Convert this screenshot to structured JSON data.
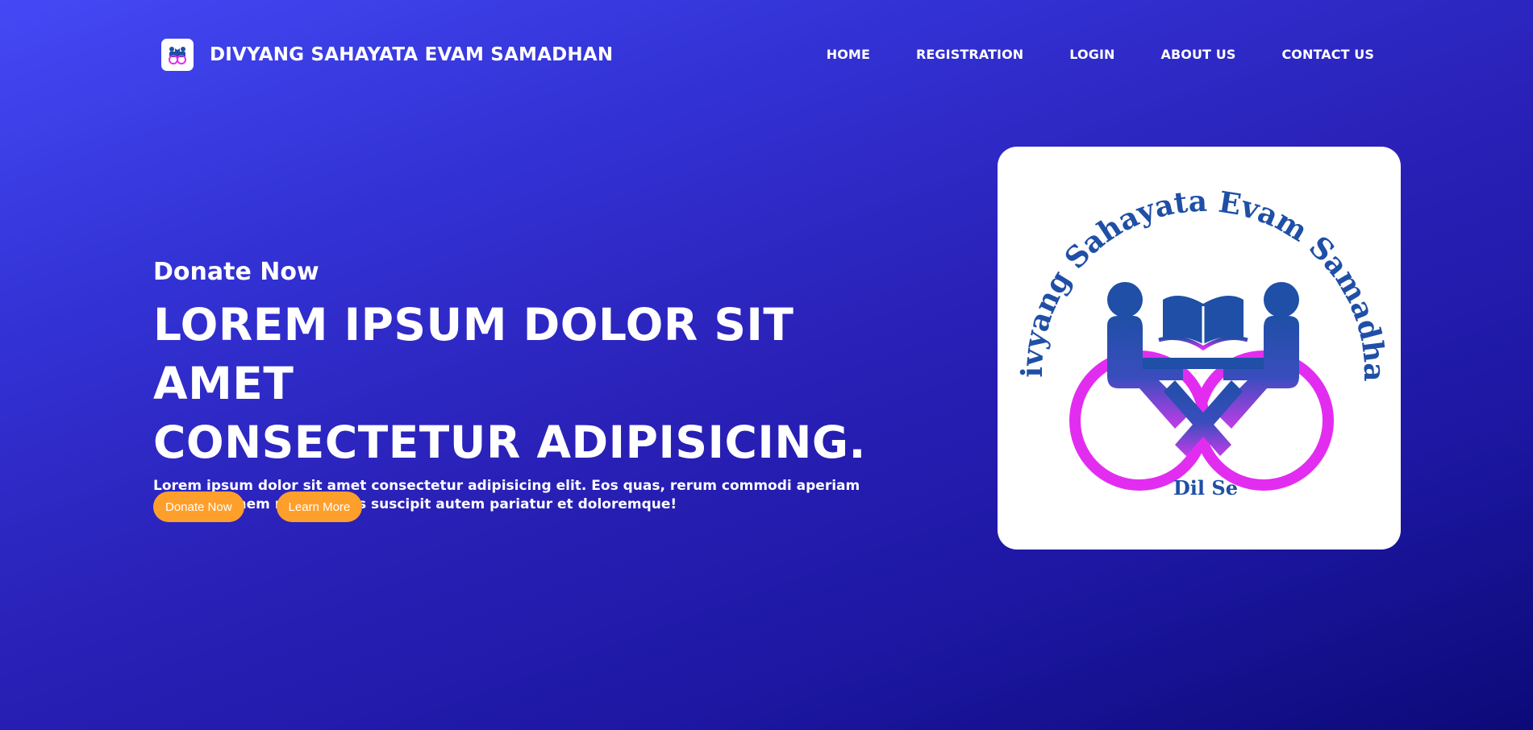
{
  "brand": {
    "name": "DIVYANG SAHAYATA EVAM SAMADHAN",
    "logo_icon": "divyang-logo-icon"
  },
  "nav": {
    "items": [
      {
        "label": "HOME"
      },
      {
        "label": "REGISTRATION"
      },
      {
        "label": "LOGIN"
      },
      {
        "label": "ABOUT US"
      },
      {
        "label": "CONTACT US"
      }
    ]
  },
  "hero": {
    "kicker": "Donate Now",
    "headline_line1": "LOREM IPSUM DOLOR SIT AMET",
    "headline_line2": "CONSECTETUR ADIPISICING.",
    "lead": "Lorem ipsum dolor sit amet consectetur adipisicing elit. Eos quas, rerum commodi aperiam exercitationem repellendus suscipit autem pariatur et doloremque!",
    "buttons": {
      "donate": "Donate Now",
      "learn": "Learn More"
    }
  },
  "logo": {
    "arc_text": "Divyang Sahayata Evam Samadhan",
    "tagline": "Dil Se"
  },
  "colors": {
    "accent": "#ff9f2b",
    "logo_blue": "#1f4fa6",
    "logo_magenta": "#e22df0",
    "bg_top": "#4549f5",
    "bg_bottom": "#0c0a78"
  }
}
